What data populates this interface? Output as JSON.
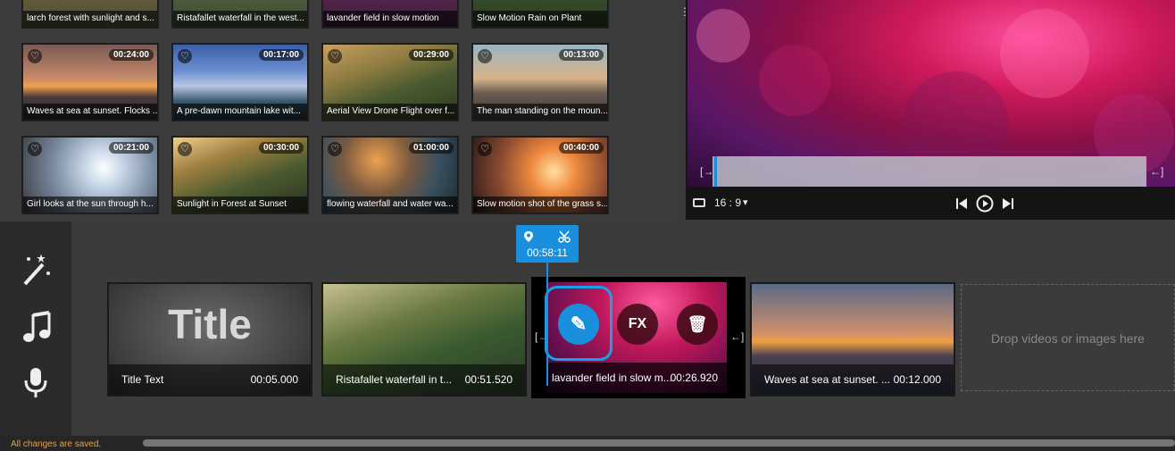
{
  "library": {
    "top_row": [
      {
        "caption": "larch forest with sunlight and s..."
      },
      {
        "caption": "Ristafallet waterfall in the west..."
      },
      {
        "caption": "lavander field in slow motion"
      },
      {
        "caption": "Slow Motion Rain on Plant"
      }
    ],
    "items": [
      {
        "caption": "Waves at sea at sunset. Flocks ...",
        "duration": "00:24:00",
        "bg": "linear-gradient(180deg,#7a5a55 0%,#c78a6a 45%,#f0a050 55%,#4a3a3a 70%,#2a2a30 100%)"
      },
      {
        "caption": "A pre-dawn mountain lake wit...",
        "duration": "00:17:00",
        "bg": "linear-gradient(180deg,#3b5fa8 0%,#6c8fd0 35%,#b7c6e4 55%,#3a5a70 75%,#1f3340 100%)"
      },
      {
        "caption": "Aerial View Drone Flight over f...",
        "duration": "00:29:00",
        "bg": "linear-gradient(160deg,#c9a060 0%,#8a7a40 35%,#4a5a30 60%,#2a3a20 100%)"
      },
      {
        "caption": "The man standing on the moun...",
        "duration": "00:13:00",
        "bg": "linear-gradient(180deg,#9ab4c4 0%,#d8b48a 45%,#6a5a50 65%,#3a3a3a 100%)"
      },
      {
        "caption": "Girl looks at the sun through h...",
        "duration": "00:21:00",
        "bg": "radial-gradient(circle at 60% 40%,#ffffff 0%,#c8d8e8 20%,#7a8aa0 55%,#3a3a40 100%)"
      },
      {
        "caption": "Sunlight in Forest at Sunset",
        "duration": "00:30:00",
        "bg": "linear-gradient(160deg,#f0d090 0%,#a08040 30%,#4a5a30 60%,#2a3020 100%)"
      },
      {
        "caption": "flowing waterfall and water wa...",
        "duration": "01:00:00",
        "bg": "radial-gradient(circle at 40% 30%,#f0a050 0%,#7a5a40 35%,#3a5060 65%,#1a2a30 100%)"
      },
      {
        "caption": "Slow motion shot of the grass s...",
        "duration": "00:40:00",
        "bg": "radial-gradient(circle at 60% 45%,#ffe0a0 0%,#f08a40 25%,#8a4a30 60%,#2a1a18 100%)"
      }
    ]
  },
  "preview": {
    "aspect_label": "16 : 9",
    "aspect_caret": "▾"
  },
  "timeline": {
    "playhead": {
      "time": "00:58:11"
    },
    "clips": [
      {
        "name": "Title Text",
        "time": "00:05.000",
        "title_overlay": "Title"
      },
      {
        "name": "Ristafallet waterfall in t...",
        "time": "00:51.520"
      },
      {
        "name": "lavander field in slow m...",
        "time": "00:26.920"
      },
      {
        "name": "Waves at sea at sunset. ...",
        "time": "00:12.000"
      }
    ],
    "actions": {
      "edit": "✎",
      "fx": "FX",
      "delete": "🗑"
    },
    "dropzone": "Drop videos or images here"
  },
  "status": {
    "saved": "All changes are saved."
  },
  "colors": {
    "accent": "#1a8fde",
    "status_text": "#f0a030"
  }
}
